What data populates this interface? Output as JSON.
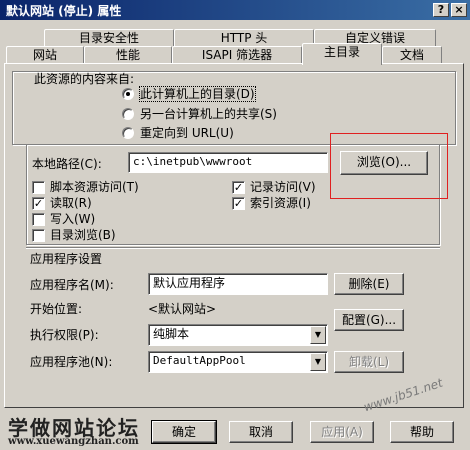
{
  "window": {
    "title": "默认网站 (停止) 属性",
    "help_button": "?",
    "close_button": "×"
  },
  "tabs": {
    "row1": [
      "目录安全性",
      "HTTP 头",
      "自定义错误"
    ],
    "row2": [
      "网站",
      "性能",
      "ISAPI 筛选器",
      "主目录",
      "文档"
    ],
    "active": "主目录"
  },
  "source": {
    "heading": "此资源的内容来自:",
    "options": [
      "此计算机上的目录(D)",
      "另一台计算机上的共享(S)",
      "重定向到 URL(U)"
    ],
    "selected_index": 0
  },
  "local_path": {
    "label": "本地路径(C):",
    "value": "c:\\inetpub\\wwwroot",
    "browse_label": "浏览(O)..."
  },
  "permissions": {
    "left": [
      {
        "label": "脚本资源访问(T)",
        "checked": false
      },
      {
        "label": "读取(R)",
        "checked": true
      },
      {
        "label": "写入(W)",
        "checked": false
      },
      {
        "label": "目录浏览(B)",
        "checked": false
      }
    ],
    "right": [
      {
        "label": "记录访问(V)",
        "checked": true
      },
      {
        "label": "索引资源(I)",
        "checked": true
      }
    ]
  },
  "app_settings": {
    "heading": "应用程序设置",
    "app_name_label": "应用程序名(M):",
    "app_name_value": "默认应用程序",
    "remove_label": "删除(E)",
    "start_label": "开始位置:",
    "start_value": "<默认网站>",
    "config_label": "配置(G)...",
    "exec_label": "执行权限(P):",
    "exec_value": "纯脚本",
    "pool_label": "应用程序池(N):",
    "pool_value": "DefaultAppPool",
    "unload_label": "卸载(L)"
  },
  "footer": {
    "ok": "确定",
    "cancel": "取消",
    "apply": "应用(A)",
    "help": "帮助"
  },
  "watermark": {
    "logo": "学做网站论坛",
    "url": "www.xuewangzhan.com",
    "site": "www.jb51.net"
  }
}
